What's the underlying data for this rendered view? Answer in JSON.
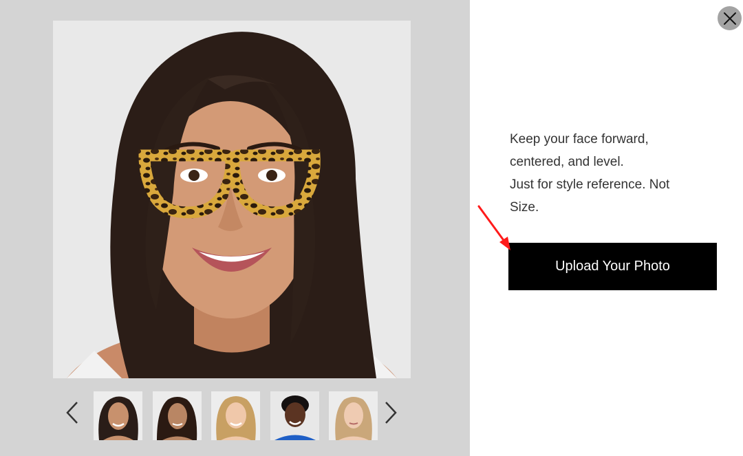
{
  "preview": {
    "image_icon": "model-face-with-glasses",
    "glasses_style": "tortoiseshell-cat-eye"
  },
  "thumbnails": [
    {
      "icon": "model-thumbnail-1",
      "skin": "#c8916d",
      "hair": "#2a1d18",
      "bg": "#ededed"
    },
    {
      "icon": "model-thumbnail-2",
      "skin": "#b98664",
      "hair": "#2b1a12",
      "bg": "#ececec"
    },
    {
      "icon": "model-thumbnail-3",
      "skin": "#f0c8aa",
      "hair": "#c8a063",
      "bg": "#ededed"
    },
    {
      "icon": "model-thumbnail-4",
      "skin": "#5b3422",
      "hair": "#141010",
      "bg": "#e8e8e8"
    },
    {
      "icon": "model-thumbnail-5",
      "skin": "#efcbb2",
      "hair": "#caa77a",
      "bg": "#ececec"
    }
  ],
  "instructions": {
    "line1": "Keep your face forward,",
    "line2": "centered, and level.",
    "line3": "Just for style reference. Not",
    "line4": "Size."
  },
  "upload_button": {
    "label": "Upload Your Photo"
  },
  "colors": {
    "left_panel_bg": "#d4d4d4",
    "button_bg": "#000000",
    "button_text": "#ffffff",
    "close_bg": "#a3a3a3",
    "annotation_arrow": "#ff1a1a"
  }
}
